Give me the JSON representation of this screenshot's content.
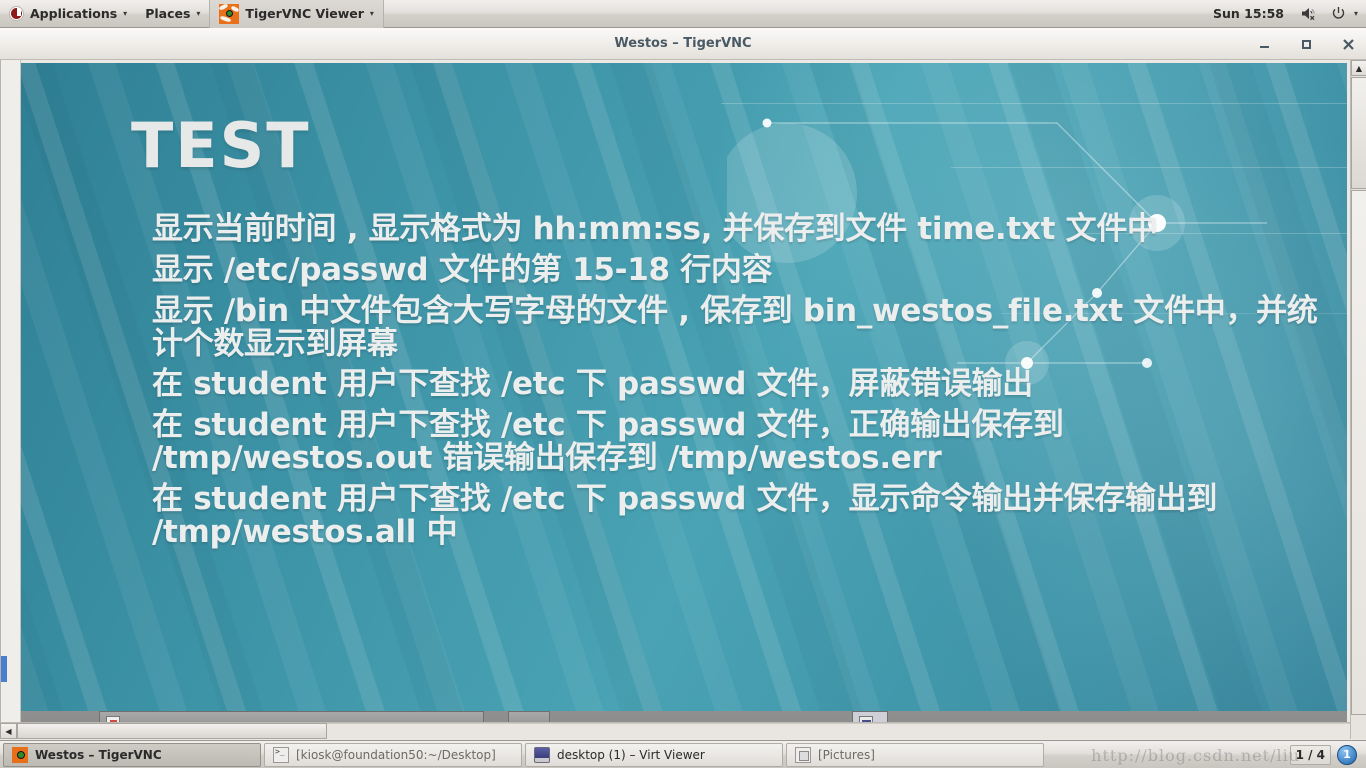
{
  "top_panel": {
    "applications_label": "Applications",
    "places_label": "Places",
    "window_label": "TigerVNC Viewer",
    "clock": "Sun 15:58",
    "volume_icon": "volume-muted-icon",
    "power_icon": "power-icon",
    "caret": "▾"
  },
  "vnc_window": {
    "title": "Westos – TigerVNC",
    "minimize_label": "–",
    "maximize_label": "□",
    "close_label": "✕"
  },
  "slide": {
    "title": "TEST",
    "bullets": [
      "显示当前时间 , 显示格式为 hh:mm:ss, 并保存到文件 time.txt 文件中",
      "显示 /etc/passwd 文件的第 15-18 行内容",
      "显示 /bin 中文件包含大写字母的文件 , 保存到 bin_westos_file.txt 文件中，并统计个数显示到屏幕",
      "在 student 用户下查找 /etc 下 passwd 文件，屏蔽错误输出",
      "在 student 用户下查找 /etc 下 passwd 文件，正确输出保存到 /tmp/westos.out 错误输出保存到 /tmp/westos.err",
      "在 student 用户下查找 /etc 下 passwd 文件，显示命令输出并保存输出到 /tmp/westos.all 中",
      "",
      ""
    ],
    "accent_bg": "#3d93a6",
    "text_color": "#eceeee"
  },
  "scrollbars": {
    "up_arrow": "▲",
    "down_arrow": "▼",
    "left_arrow": "◀",
    "right_arrow": "▶"
  },
  "taskbar": {
    "items": [
      {
        "label": "Westos – TigerVNC",
        "icon": "tiger-icon",
        "active": true
      },
      {
        "label": "[kiosk@foundation50:~/Desktop]",
        "icon": "terminal-icon",
        "active": false
      },
      {
        "label": "desktop (1) – Virt Viewer",
        "icon": "monitor-icon",
        "active": false
      },
      {
        "label": "[Pictures]",
        "icon": "pictures-icon",
        "active": false
      }
    ],
    "watermark": "http://blog.csdn.net/liu",
    "workspace_count": "1 / 4",
    "workspace_badge": "1"
  },
  "inner_taskbar": {
    "items": [
      {
        "label": "",
        "icon": "app-red-icon"
      },
      {
        "label": "",
        "icon": "app-blank-icon"
      },
      {
        "label": "",
        "icon": "app-blue-icon"
      }
    ]
  }
}
